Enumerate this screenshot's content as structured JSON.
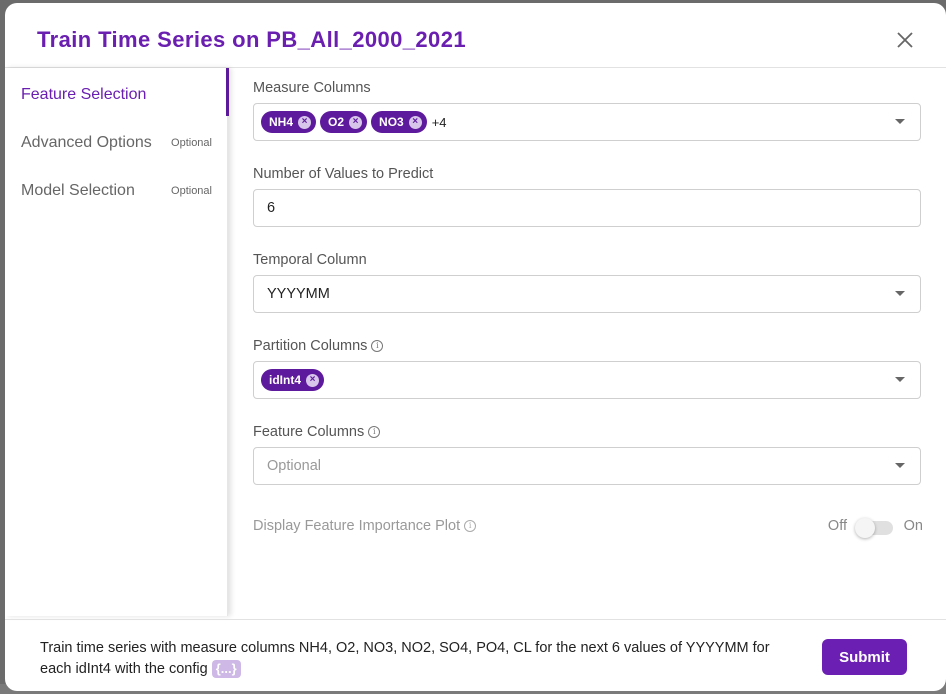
{
  "modal": {
    "title": "Train Time Series on PB_All_2000_2021",
    "close_icon": "close-icon"
  },
  "sidebar": {
    "items": [
      {
        "label": "Feature Selection",
        "badge": "",
        "active": true
      },
      {
        "label": "Advanced Options",
        "badge": "Optional",
        "active": false
      },
      {
        "label": "Model Selection",
        "badge": "Optional",
        "active": false
      }
    ]
  },
  "form": {
    "measure_columns": {
      "label": "Measure Columns",
      "chips": [
        "NH4",
        "O2",
        "NO3"
      ],
      "more": "+4"
    },
    "num_values": {
      "label": "Number of Values to Predict",
      "value": "6"
    },
    "temporal_column": {
      "label": "Temporal Column",
      "value": "YYYYMM"
    },
    "partition_columns": {
      "label": "Partition Columns",
      "chips": [
        "idInt4"
      ]
    },
    "feature_columns": {
      "label": "Feature Columns",
      "placeholder": "Optional"
    },
    "feature_importance": {
      "label": "Display Feature Importance Plot",
      "off_label": "Off",
      "on_label": "On",
      "enabled": false
    }
  },
  "footer": {
    "summary": " Train time series with measure columns NH4, O2, NO3, NO2, SO4, PO4, CL for the next 6 values of YYYYMM for each idInt4 with the config",
    "config_badge": "{...}",
    "submit_label": "Submit"
  },
  "colors": {
    "accent": "#6a1fb0",
    "chip": "#5e1a9c",
    "config_badge": "#cdb8e6"
  }
}
